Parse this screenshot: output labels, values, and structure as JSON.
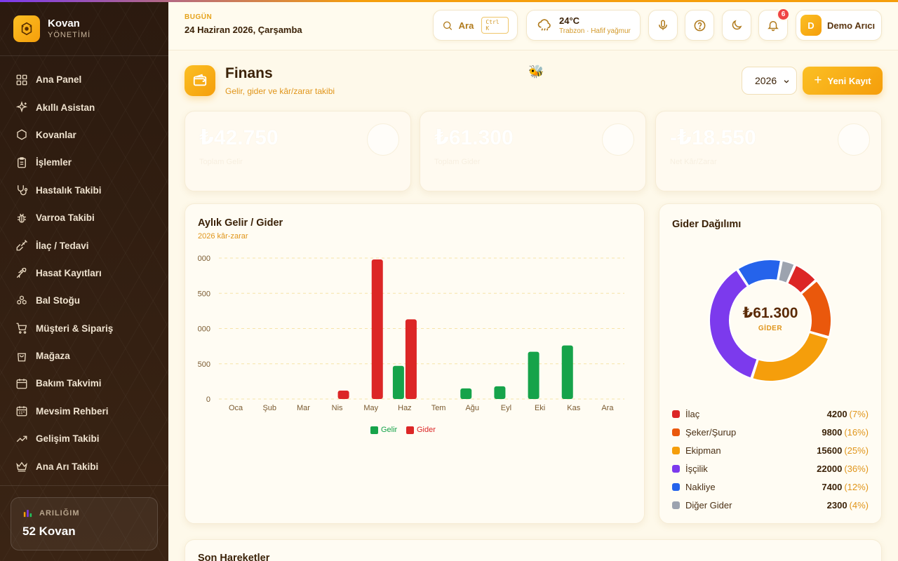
{
  "brand": {
    "name": "Kovan",
    "subtitle": "YÖNETİMİ"
  },
  "sidebar": {
    "items": [
      {
        "label": "Ana Panel",
        "icon": "grid-icon"
      },
      {
        "label": "Akıllı Asistan",
        "icon": "sparkle-icon"
      },
      {
        "label": "Kovanlar",
        "icon": "hexagon-icon"
      },
      {
        "label": "İşlemler",
        "icon": "clipboard-icon"
      },
      {
        "label": "Hastalık Takibi",
        "icon": "stethoscope-icon"
      },
      {
        "label": "Varroa Takibi",
        "icon": "bug-icon"
      },
      {
        "label": "İlaç / Tedavi",
        "icon": "syringe-icon"
      },
      {
        "label": "Hasat Kayıtları",
        "icon": "wheat-icon"
      },
      {
        "label": "Bal Stoğu",
        "icon": "honeycomb-icon"
      },
      {
        "label": "Müşteri & Sipariş",
        "icon": "cart-icon"
      },
      {
        "label": "Mağaza",
        "icon": "bag-icon"
      },
      {
        "label": "Bakım Takvimi",
        "icon": "calendar-icon"
      },
      {
        "label": "Mevsim Rehberi",
        "icon": "calendar-grid-icon"
      },
      {
        "label": "Gelişim Takibi",
        "icon": "trend-icon"
      },
      {
        "label": "Ana Arı Takibi",
        "icon": "crown-icon"
      }
    ]
  },
  "farm": {
    "label": "ARILIĞIM",
    "value": "52 Kovan"
  },
  "header": {
    "today_label": "BUGÜN",
    "today_date": "24 Haziran 2026, Çarşamba",
    "search_label": "Ara",
    "search_kbd": "Ctrl K",
    "weather_temp": "24°C",
    "weather_desc": "Trabzon · Hafif yağmur",
    "notif_count": "6",
    "user_initial": "D",
    "user_name": "Demo Arıcı"
  },
  "page": {
    "title": "Finans",
    "subtitle": "Gelir, gider ve kâr/zarar takibi",
    "year": "2026",
    "new_label": "Yeni Kayıt"
  },
  "stats": [
    {
      "value": "₺42.750",
      "label": "Toplam Gelir"
    },
    {
      "value": "₺61.300",
      "label": "Toplam Gider"
    },
    {
      "value": "-₺18.550",
      "label": "Net Kâr/Zarar"
    }
  ],
  "colors": {
    "accent": "#f59e0b",
    "income": "#16a34a",
    "expense": "#dc2626"
  },
  "chart_data": [
    {
      "type": "bar",
      "title": "Aylık Gelir / Gider",
      "subtitle": "2026 kâr-zarar",
      "categories": [
        "Oca",
        "Şub",
        "Mar",
        "Nis",
        "May",
        "Haz",
        "Tem",
        "Ağu",
        "Eyl",
        "Eki",
        "Kas",
        "Ara"
      ],
      "ytick_labels": [
        "0",
        "500",
        "000",
        "500",
        "000"
      ],
      "ylim": [
        0,
        20000
      ],
      "series": [
        {
          "name": "Gelir",
          "color": "#16a34a",
          "values": [
            0,
            0,
            0,
            0,
            0,
            4700,
            0,
            1500,
            1800,
            6700,
            7600,
            0
          ]
        },
        {
          "name": "Gider",
          "color": "#dc2626",
          "values": [
            0,
            0,
            0,
            1200,
            19800,
            11300,
            0,
            0,
            0,
            0,
            0,
            0
          ]
        }
      ],
      "legend": "bottom",
      "grid": true
    },
    {
      "type": "pie",
      "title": "Gider Dağılımı",
      "center_value": "₺61.300",
      "center_label": "GİDER",
      "slices": [
        {
          "name": "İlaç",
          "value": 4200,
          "value_text": "4200",
          "pct": "(7%)",
          "color": "#dc2626"
        },
        {
          "name": "Şeker/Şurup",
          "value": 9800,
          "value_text": "9800",
          "pct": "(16%)",
          "color": "#ea580c"
        },
        {
          "name": "Ekipman",
          "value": 15600,
          "value_text": "15600",
          "pct": "(25%)",
          "color": "#f59e0b"
        },
        {
          "name": "İşçilik",
          "value": 22000,
          "value_text": "22000",
          "pct": "(36%)",
          "color": "#7c3aed"
        },
        {
          "name": "Nakliye",
          "value": 7400,
          "value_text": "7400",
          "pct": "(12%)",
          "color": "#2563eb"
        },
        {
          "name": "Diğer Gider",
          "value": 2300,
          "value_text": "2300",
          "pct": "(4%)",
          "color": "#9ca3af"
        }
      ]
    }
  ],
  "recent_title": "Son Hareketler"
}
